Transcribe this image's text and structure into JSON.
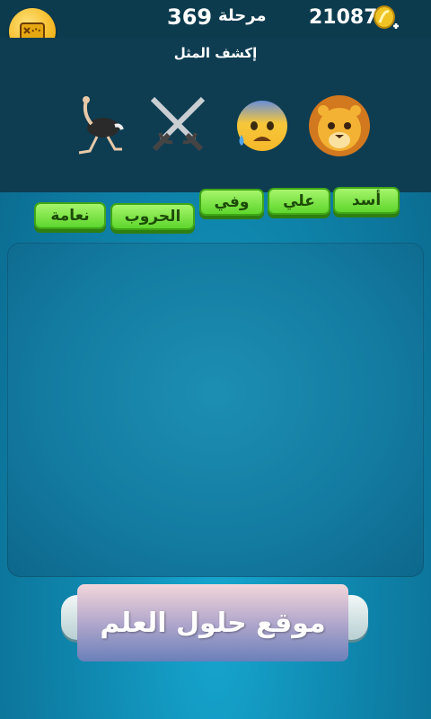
{
  "header": {
    "level_label": "مرحلة",
    "level_number": "369",
    "coins": "210878",
    "map_button_icon": "map-icon",
    "coin_icon": "coin-plus-icon"
  },
  "puzzle": {
    "title": "إكشف المثل",
    "emojis": [
      "lion-emoji",
      "anxious-sweat-face-emoji",
      "crossed-swords-emoji",
      "ostrich-emoji"
    ]
  },
  "words": [
    "أسد",
    "علي",
    "وفي",
    "الحروب",
    "نعامة"
  ],
  "watermark": "موقع حلول العلم",
  "colors": {
    "word_tile": "#7be845",
    "board": "#137aa0",
    "header": "#0e3d52"
  }
}
